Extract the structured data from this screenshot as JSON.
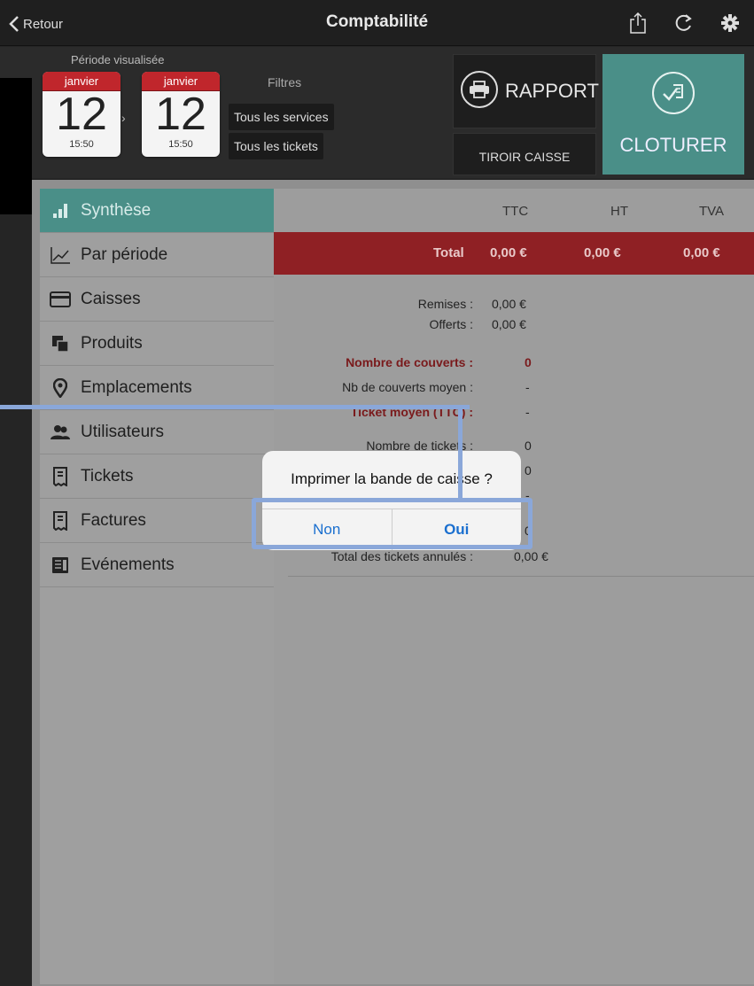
{
  "topbar": {
    "back_label": "Retour",
    "title": "Comptabilité",
    "icons": [
      "share-icon",
      "refresh-icon",
      "gear-icon"
    ]
  },
  "period": {
    "label": "Période visualisée",
    "start": {
      "month": "janvier",
      "day": "12",
      "time": "15:50"
    },
    "end": {
      "month": "janvier",
      "day": "12",
      "time": "15:50"
    },
    "separator": "›"
  },
  "filters": {
    "label": "Filtres",
    "services": "Tous les services",
    "tickets": "Tous les tickets"
  },
  "actions": {
    "rapport": "RAPPORT",
    "tiroir": "TIROIR CAISSE",
    "cloturer": "CLOTURER"
  },
  "sidebar": {
    "items": [
      {
        "label": "Synthèse",
        "icon": "bar-chart-icon",
        "active": true
      },
      {
        "label": "Par période",
        "icon": "line-chart-icon"
      },
      {
        "label": "Caisses",
        "icon": "card-icon"
      },
      {
        "label": "Produits",
        "icon": "products-icon"
      },
      {
        "label": "Emplacements",
        "icon": "location-pin-icon"
      },
      {
        "label": "Utilisateurs",
        "icon": "users-icon"
      },
      {
        "label": "Tickets",
        "icon": "ticket-icon"
      },
      {
        "label": "Factures",
        "icon": "invoice-icon"
      },
      {
        "label": "Evénements",
        "icon": "events-icon"
      }
    ]
  },
  "table": {
    "headers": {
      "ttc": "TTC",
      "ht": "HT",
      "tva": "TVA"
    },
    "total": {
      "label": "Total",
      "ttc": "0,00 €",
      "ht": "0,00 €",
      "tva": "0,00 €"
    }
  },
  "stats": [
    {
      "label": "Remises :",
      "value": "0,00 €"
    },
    {
      "label": "Offerts :",
      "value": "0,00 €"
    },
    {
      "label": "Nombre de couverts :",
      "value": "0"
    },
    {
      "label": "Nb de couverts moyen :",
      "value": "-"
    },
    {
      "label": "Ticket moyen (TTC) :",
      "value": "-"
    },
    {
      "label": "Nombre de tickets :",
      "value": "0"
    },
    {
      "label": "",
      "value": "0"
    },
    {
      "label": "",
      "value": "-"
    },
    {
      "label": "",
      "value": "0"
    },
    {
      "label": "Total des tickets annulés :",
      "value": "0,00 €"
    }
  ],
  "dialog": {
    "question": "Imprimer la bande de caisse ?",
    "no": "Non",
    "yes": "Oui"
  },
  "colors": {
    "accent_teal": "#4a8f88",
    "total_red": "#8f2024",
    "highlight_blue": "#8aa7d9",
    "link_blue": "#1a6fcf"
  }
}
